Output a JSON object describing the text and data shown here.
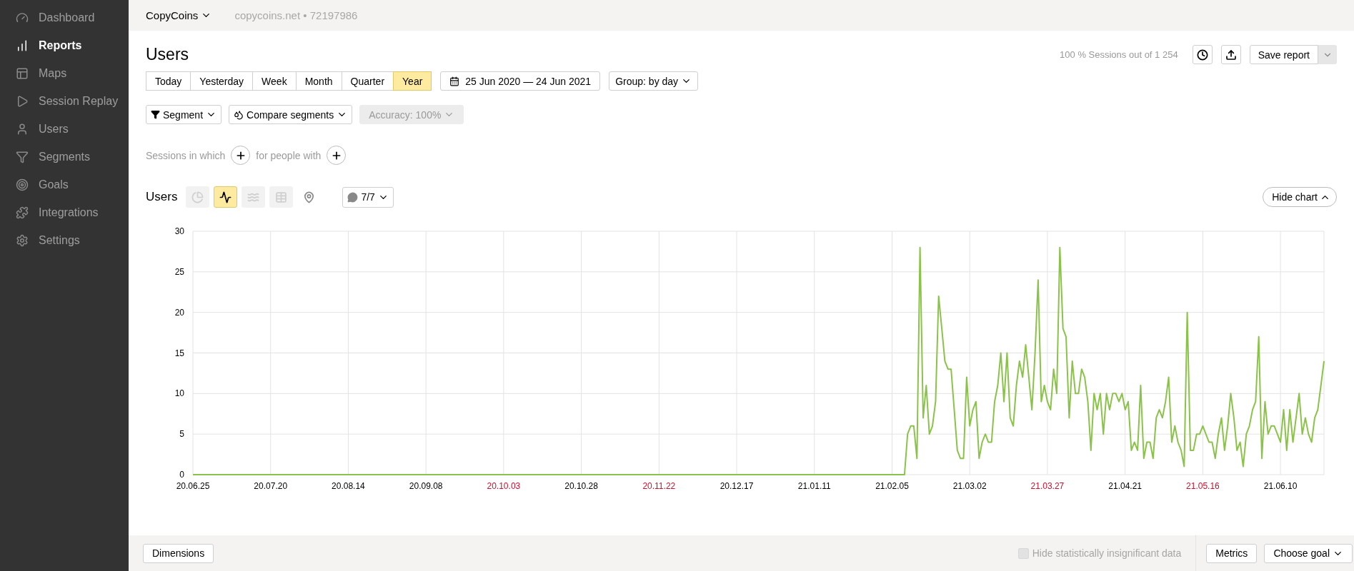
{
  "sidebar": {
    "items": [
      {
        "label": "Dashboard",
        "selected": false
      },
      {
        "label": "Reports",
        "selected": true
      },
      {
        "label": "Maps",
        "selected": false
      },
      {
        "label": "Session Replay",
        "selected": false
      },
      {
        "label": "Users",
        "selected": false
      },
      {
        "label": "Segments",
        "selected": false
      },
      {
        "label": "Goals",
        "selected": false
      },
      {
        "label": "Integrations",
        "selected": false
      },
      {
        "label": "Settings",
        "selected": false
      }
    ]
  },
  "top_bar": {
    "counter_name": "CopyCoins",
    "site": "copycoins.net",
    "separator": "•",
    "counter_id": "72197986"
  },
  "report": {
    "title": "Users",
    "sampling": "100 % Sessions out of 1 254",
    "save_button": "Save report"
  },
  "periods": [
    {
      "label": "Today",
      "selected": false
    },
    {
      "label": "Yesterday",
      "selected": false
    },
    {
      "label": "Week",
      "selected": false
    },
    {
      "label": "Month",
      "selected": false
    },
    {
      "label": "Quarter",
      "selected": false
    },
    {
      "label": "Year",
      "selected": true
    }
  ],
  "date_range": "25 Jun 2020 — 24 Jun 2021",
  "group": "Group: by day",
  "filters": {
    "segment": "Segment",
    "compare": "Compare segments",
    "accuracy": {
      "label": "Accuracy: 100%",
      "disabled": true
    }
  },
  "conditions": [
    "Sessions in which",
    "for people with"
  ],
  "chart_header": {
    "chart_types": [
      {
        "kind": "pie",
        "selected": false
      },
      {
        "kind": "line",
        "selected": true
      },
      {
        "kind": "area",
        "selected": false
      },
      {
        "kind": "bar",
        "selected": false
      },
      {
        "kind": "map",
        "selected": false
      }
    ],
    "annotations": "7/7",
    "hide_chart": "Hide chart"
  },
  "chart": {
    "x_label_highlighted": [
      false,
      false,
      false,
      false,
      true,
      false,
      true,
      false,
      false,
      false,
      false,
      true,
      false,
      true,
      false
    ],
    "chart_data": {
      "type": "line",
      "grid": true,
      "ylim": [
        0,
        30
      ],
      "yticks": [
        0,
        5,
        10,
        15,
        20,
        25,
        30
      ],
      "categories": [
        "20.06.25",
        null,
        null,
        null,
        null,
        null,
        null,
        null,
        null,
        null,
        null,
        null,
        null,
        null,
        null,
        null,
        null,
        null,
        null,
        null,
        null,
        null,
        null,
        null,
        null,
        "20.07.20",
        null,
        null,
        null,
        null,
        null,
        null,
        null,
        null,
        null,
        null,
        null,
        null,
        null,
        null,
        null,
        null,
        null,
        null,
        null,
        null,
        null,
        null,
        null,
        null,
        "20.08.14",
        null,
        null,
        null,
        null,
        null,
        null,
        null,
        null,
        null,
        null,
        null,
        null,
        null,
        null,
        null,
        null,
        null,
        null,
        null,
        null,
        null,
        null,
        null,
        null,
        "20.09.08",
        null,
        null,
        null,
        null,
        null,
        null,
        null,
        null,
        null,
        null,
        null,
        null,
        null,
        null,
        null,
        null,
        null,
        null,
        null,
        null,
        null,
        null,
        null,
        null,
        "20.10.03",
        null,
        null,
        null,
        null,
        null,
        null,
        null,
        null,
        null,
        null,
        null,
        null,
        null,
        null,
        null,
        null,
        null,
        null,
        null,
        null,
        null,
        null,
        null,
        null,
        "20.10.28",
        null,
        null,
        null,
        null,
        null,
        null,
        null,
        null,
        null,
        null,
        null,
        null,
        null,
        null,
        null,
        null,
        null,
        null,
        null,
        null,
        null,
        null,
        null,
        null,
        "20.11.22",
        null,
        null,
        null,
        null,
        null,
        null,
        null,
        null,
        null,
        null,
        null,
        null,
        null,
        null,
        null,
        null,
        null,
        null,
        null,
        null,
        null,
        null,
        null,
        null,
        "20.12.17",
        null,
        null,
        null,
        null,
        null,
        null,
        null,
        null,
        null,
        null,
        null,
        null,
        null,
        null,
        null,
        null,
        null,
        null,
        null,
        null,
        null,
        null,
        null,
        null,
        "21.01.11",
        null,
        null,
        null,
        null,
        null,
        null,
        null,
        null,
        null,
        null,
        null,
        null,
        null,
        null,
        null,
        null,
        null,
        null,
        null,
        null,
        null,
        null,
        null,
        null,
        "21.02.05",
        null,
        null,
        null,
        null,
        null,
        null,
        null,
        null,
        null,
        null,
        null,
        null,
        null,
        null,
        null,
        null,
        null,
        null,
        null,
        null,
        null,
        null,
        null,
        null,
        "21.03.02",
        null,
        null,
        null,
        null,
        null,
        null,
        null,
        null,
        null,
        null,
        null,
        null,
        null,
        null,
        null,
        null,
        null,
        null,
        null,
        null,
        null,
        null,
        null,
        null,
        "21.03.27",
        null,
        null,
        null,
        null,
        null,
        null,
        null,
        null,
        null,
        null,
        null,
        null,
        null,
        null,
        null,
        null,
        null,
        null,
        null,
        null,
        null,
        null,
        null,
        null,
        "21.04.21",
        null,
        null,
        null,
        null,
        null,
        null,
        null,
        null,
        null,
        null,
        null,
        null,
        null,
        null,
        null,
        null,
        null,
        null,
        null,
        null,
        null,
        null,
        null,
        null,
        "21.05.16",
        null,
        null,
        null,
        null,
        null,
        null,
        null,
        null,
        null,
        null,
        null,
        null,
        null,
        null,
        null,
        null,
        null,
        null,
        null,
        null,
        null,
        null,
        null,
        null,
        "21.06.10",
        null,
        null,
        null,
        null,
        null,
        null,
        null,
        null,
        null,
        null,
        null,
        null,
        null,
        null
      ],
      "series": [
        {
          "name": "Users",
          "color": "#8bc34a",
          "values": [
            0,
            0,
            0,
            0,
            0,
            0,
            0,
            0,
            0,
            0,
            0,
            0,
            0,
            0,
            0,
            0,
            0,
            0,
            0,
            0,
            0,
            0,
            0,
            0,
            0,
            0,
            0,
            0,
            0,
            0,
            0,
            0,
            0,
            0,
            0,
            0,
            0,
            0,
            0,
            0,
            0,
            0,
            0,
            0,
            0,
            0,
            0,
            0,
            0,
            0,
            0,
            0,
            0,
            0,
            0,
            0,
            0,
            0,
            0,
            0,
            0,
            0,
            0,
            0,
            0,
            0,
            0,
            0,
            0,
            0,
            0,
            0,
            0,
            0,
            0,
            0,
            0,
            0,
            0,
            0,
            0,
            0,
            0,
            0,
            0,
            0,
            0,
            0,
            0,
            0,
            0,
            0,
            0,
            0,
            0,
            0,
            0,
            0,
            0,
            0,
            0,
            0,
            0,
            0,
            0,
            0,
            0,
            0,
            0,
            0,
            0,
            0,
            0,
            0,
            0,
            0,
            0,
            0,
            0,
            0,
            0,
            0,
            0,
            0,
            0,
            0,
            0,
            0,
            0,
            0,
            0,
            0,
            0,
            0,
            0,
            0,
            0,
            0,
            0,
            0,
            0,
            0,
            0,
            0,
            0,
            0,
            0,
            0,
            0,
            0,
            0,
            0,
            0,
            0,
            0,
            0,
            0,
            0,
            0,
            0,
            0,
            0,
            0,
            0,
            0,
            0,
            0,
            0,
            0,
            0,
            0,
            0,
            0,
            0,
            0,
            0,
            0,
            0,
            0,
            0,
            0,
            0,
            0,
            0,
            0,
            0,
            0,
            0,
            0,
            0,
            0,
            0,
            0,
            0,
            0,
            0,
            0,
            0,
            0,
            0,
            0,
            0,
            0,
            0,
            0,
            0,
            0,
            0,
            0,
            0,
            0,
            0,
            0,
            0,
            0,
            0,
            0,
            0,
            0,
            0,
            0,
            0,
            0,
            0,
            0,
            0,
            0,
            0,
            0,
            0,
            5,
            6,
            6,
            2,
            28,
            7,
            11,
            5,
            6,
            9,
            22,
            18,
            14,
            13,
            13,
            8,
            3,
            2,
            2,
            12,
            6,
            8,
            9,
            2,
            4,
            5,
            4,
            4,
            9,
            11,
            15,
            9,
            15,
            7,
            6,
            11,
            14,
            12,
            16,
            12,
            8,
            15,
            24,
            9,
            11,
            9,
            8,
            13,
            10,
            28,
            18,
            17,
            7,
            14,
            10,
            10,
            13,
            12,
            9,
            3,
            10,
            8,
            10,
            5,
            10,
            8,
            10,
            10,
            9,
            10,
            8,
            9,
            3,
            4,
            3,
            11,
            2,
            4,
            4,
            2,
            7,
            8,
            7,
            9,
            12,
            4,
            6,
            4,
            3,
            1,
            20,
            3,
            3,
            5,
            5,
            6,
            5,
            4,
            4,
            2,
            5,
            7,
            3,
            6,
            10,
            7,
            3,
            4,
            1,
            5,
            6,
            8,
            9,
            17,
            2,
            9,
            5,
            6,
            6,
            5,
            4,
            8,
            3,
            8,
            4,
            7,
            10,
            5,
            7,
            5,
            4,
            7,
            8,
            11,
            14
          ]
        }
      ]
    }
  },
  "footer": {
    "dimensions": "Dimensions",
    "hide_insignificant": {
      "label": "Hide statistically insignificant data",
      "checked": false,
      "disabled": true
    },
    "metrics": "Metrics",
    "goal": "Choose goal"
  }
}
